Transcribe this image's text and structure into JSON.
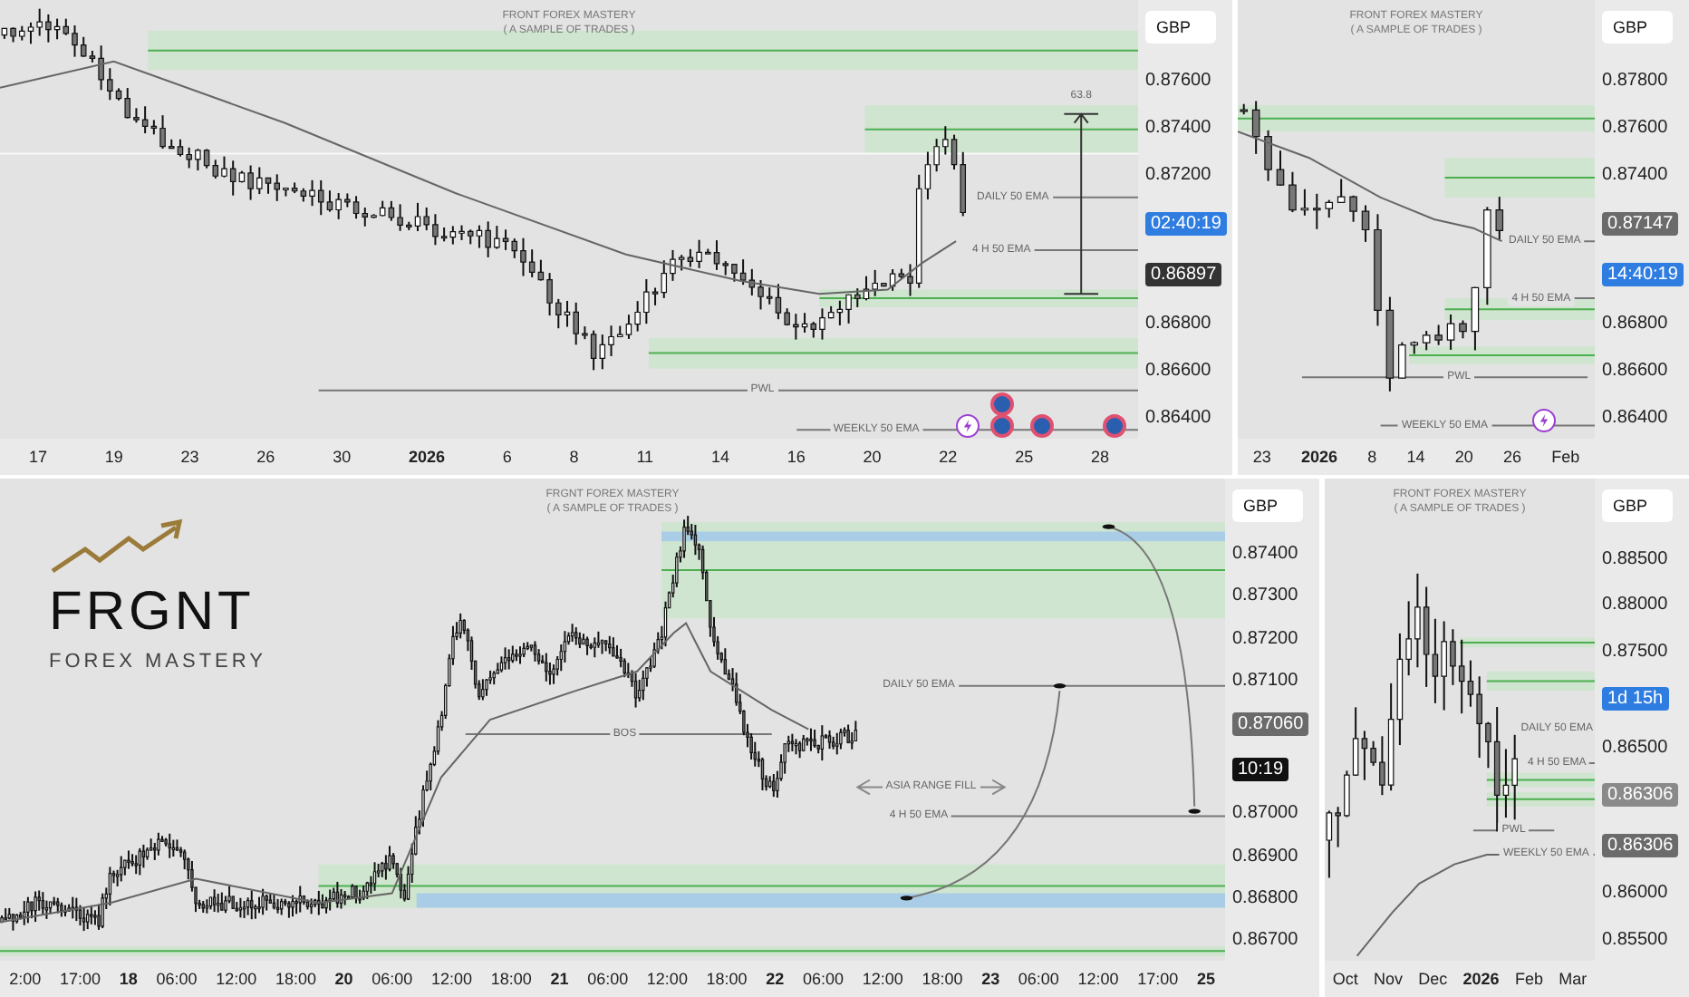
{
  "panels": [
    {
      "header": [
        "FRONT FOREX MASTERY",
        "( A SAMPLE OF TRADES )"
      ],
      "currency": "GBP",
      "price_axis": [
        {
          "kind": "price",
          "text": "0.87600"
        },
        {
          "kind": "price",
          "text": "0.87400"
        },
        {
          "kind": "price",
          "text": "0.87200"
        },
        {
          "kind": "tag",
          "text": "02:40:19",
          "color": "#2f7de1"
        },
        {
          "kind": "tag",
          "text": "0.86897",
          "color": "#333333"
        },
        {
          "kind": "price",
          "text": "0.86800"
        },
        {
          "kind": "price",
          "text": "0.86600"
        },
        {
          "kind": "price",
          "text": "0.86400"
        }
      ],
      "time_axis": [
        {
          "text": "17",
          "bold": false
        },
        {
          "text": "19",
          "bold": false
        },
        {
          "text": "23",
          "bold": false
        },
        {
          "text": "26",
          "bold": false
        },
        {
          "text": "30",
          "bold": false
        },
        {
          "text": "2026",
          "bold": true
        },
        {
          "text": "6",
          "bold": false
        },
        {
          "text": "8",
          "bold": false
        },
        {
          "text": "11",
          "bold": false
        },
        {
          "text": "14",
          "bold": false
        },
        {
          "text": "16",
          "bold": false
        },
        {
          "text": "20",
          "bold": false
        },
        {
          "text": "22",
          "bold": false
        },
        {
          "text": "25",
          "bold": false
        },
        {
          "text": "28",
          "bold": false
        }
      ],
      "annotations": [
        "63.8",
        "DAILY 50 EMA",
        "4 H 50 EMA",
        "PWL",
        "WEEKLY 50 EMA"
      ]
    },
    {
      "header": [
        "FRONT FOREX MASTERY",
        "( A SAMPLE OF TRADES )"
      ],
      "currency": "GBP",
      "price_axis": [
        {
          "kind": "price",
          "text": "0.87800"
        },
        {
          "kind": "price",
          "text": "0.87600"
        },
        {
          "kind": "price",
          "text": "0.87400"
        },
        {
          "kind": "tag",
          "text": "0.87147",
          "color": "#6b6b6b"
        },
        {
          "kind": "tag",
          "text": "14:40:19",
          "color": "#2f7de1"
        },
        {
          "kind": "price",
          "text": "0.86800"
        },
        {
          "kind": "price",
          "text": "0.86600"
        },
        {
          "kind": "price",
          "text": "0.86400"
        }
      ],
      "time_axis": [
        {
          "text": "23",
          "bold": false
        },
        {
          "text": "2026",
          "bold": true
        },
        {
          "text": "8",
          "bold": false
        },
        {
          "text": "14",
          "bold": false
        },
        {
          "text": "20",
          "bold": false
        },
        {
          "text": "26",
          "bold": false
        },
        {
          "text": "Feb",
          "bold": false
        }
      ],
      "annotations": [
        "DAILY 50 EMA",
        "4 H 50 EMA",
        "PWL",
        "WEEKLY 50 EMA"
      ]
    },
    {
      "header": [
        "FRGNT FOREX MASTERY",
        "( A SAMPLE OF TRADES )"
      ],
      "currency": "GBP",
      "logo": {
        "name": "FRGNT",
        "tagline": "FOREX MASTERY"
      },
      "price_axis": [
        {
          "kind": "price",
          "text": "0.87400"
        },
        {
          "kind": "price",
          "text": "0.87300"
        },
        {
          "kind": "price",
          "text": "0.87200"
        },
        {
          "kind": "price",
          "text": "0.87100"
        },
        {
          "kind": "tag",
          "text": "0.87060",
          "color": "#6b6b6b"
        },
        {
          "kind": "tag",
          "text": "10:19",
          "color": "#111111"
        },
        {
          "kind": "price",
          "text": "0.87000"
        },
        {
          "kind": "price",
          "text": "0.86900"
        },
        {
          "kind": "price",
          "text": "0.86800"
        },
        {
          "kind": "price",
          "text": "0.86700"
        }
      ],
      "time_axis": [
        {
          "text": "2:00",
          "bold": false
        },
        {
          "text": "17:00",
          "bold": false
        },
        {
          "text": "18",
          "bold": true
        },
        {
          "text": "06:00",
          "bold": false
        },
        {
          "text": "12:00",
          "bold": false
        },
        {
          "text": "18:00",
          "bold": false
        },
        {
          "text": "20",
          "bold": true
        },
        {
          "text": "06:00",
          "bold": false
        },
        {
          "text": "12:00",
          "bold": false
        },
        {
          "text": "18:00",
          "bold": false
        },
        {
          "text": "21",
          "bold": true
        },
        {
          "text": "06:00",
          "bold": false
        },
        {
          "text": "12:00",
          "bold": false
        },
        {
          "text": "18:00",
          "bold": false
        },
        {
          "text": "22",
          "bold": true
        },
        {
          "text": "06:00",
          "bold": false
        },
        {
          "text": "12:00",
          "bold": false
        },
        {
          "text": "18:00",
          "bold": false
        },
        {
          "text": "23",
          "bold": true
        },
        {
          "text": "06:00",
          "bold": false
        },
        {
          "text": "12:00",
          "bold": false
        },
        {
          "text": "17:00",
          "bold": false
        },
        {
          "text": "25",
          "bold": true
        }
      ],
      "annotations": [
        "BOS",
        "DAILY 50 EMA",
        "ASIA RANGE FILL",
        "4 H 50 EMA"
      ]
    },
    {
      "header": [
        "FRONT FOREX MASTERY",
        "( A SAMPLE OF TRADES )"
      ],
      "currency": "GBP",
      "price_axis": [
        {
          "kind": "price",
          "text": "0.88500"
        },
        {
          "kind": "price",
          "text": "0.88000"
        },
        {
          "kind": "price",
          "text": "0.87500"
        },
        {
          "kind": "tag",
          "text": "1d 15h",
          "color": "#2f7de1"
        },
        {
          "kind": "price",
          "text": "0.86500"
        },
        {
          "kind": "tag",
          "text": "0.86306",
          "color": "#8a8a8a"
        },
        {
          "kind": "tag",
          "text": "0.86306",
          "color": "#6b6b6b"
        },
        {
          "kind": "price",
          "text": "0.86000"
        },
        {
          "kind": "price",
          "text": "0.85500"
        }
      ],
      "time_axis": [
        {
          "text": "Oct",
          "bold": false
        },
        {
          "text": "Nov",
          "bold": false
        },
        {
          "text": "Dec",
          "bold": false
        },
        {
          "text": "2026",
          "bold": true
        },
        {
          "text": "Feb",
          "bold": false
        },
        {
          "text": "Mar",
          "bold": false
        }
      ],
      "annotations": [
        "DAILY 50 EMA",
        "4 H 50 EMA",
        "PWL",
        "WEEKLY 50 EMA"
      ]
    }
  ]
}
